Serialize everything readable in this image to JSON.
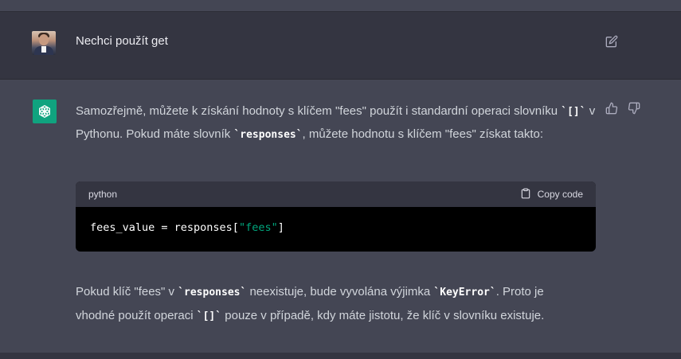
{
  "user_message": {
    "text": "Nechci použít get",
    "edit_icon": "edit-icon"
  },
  "assistant_message": {
    "para1": {
      "t1": "Samozřejmě, můžete k získání hodnoty s klíčem \"fees\" použít i standardní operaci slovníku ",
      "c1": "`[]`",
      "t2": " v Pythonu. Pokud máte slovník ",
      "c2": "`responses`",
      "t3": ", můžete hodnotu s klíčem \"fees\" získat takto:"
    },
    "code_block": {
      "language": "python",
      "copy_label": "Copy code",
      "code_prefix": "fees_value = responses[",
      "code_string": "\"fees\"",
      "code_suffix": "]"
    },
    "para2": {
      "t1": "Pokud klíč \"fees\" v ",
      "c1": "`responses`",
      "t2": " neexistuje, bude vyvolána výjimka ",
      "c2": "`KeyError`",
      "t3": ". Proto je vhodné použít operaci ",
      "c3": "`[]`",
      "t4": " pouze v případě, kdy máte jistotu, že klíč v slovníku existuje."
    },
    "icons": [
      "openai-logo-icon",
      "thumbs-up-icon",
      "thumbs-down-icon"
    ]
  },
  "colors": {
    "background_assistant": "#444654",
    "background_user": "#343541",
    "logo_green": "#10a37f",
    "string_green": "#00a67d"
  }
}
